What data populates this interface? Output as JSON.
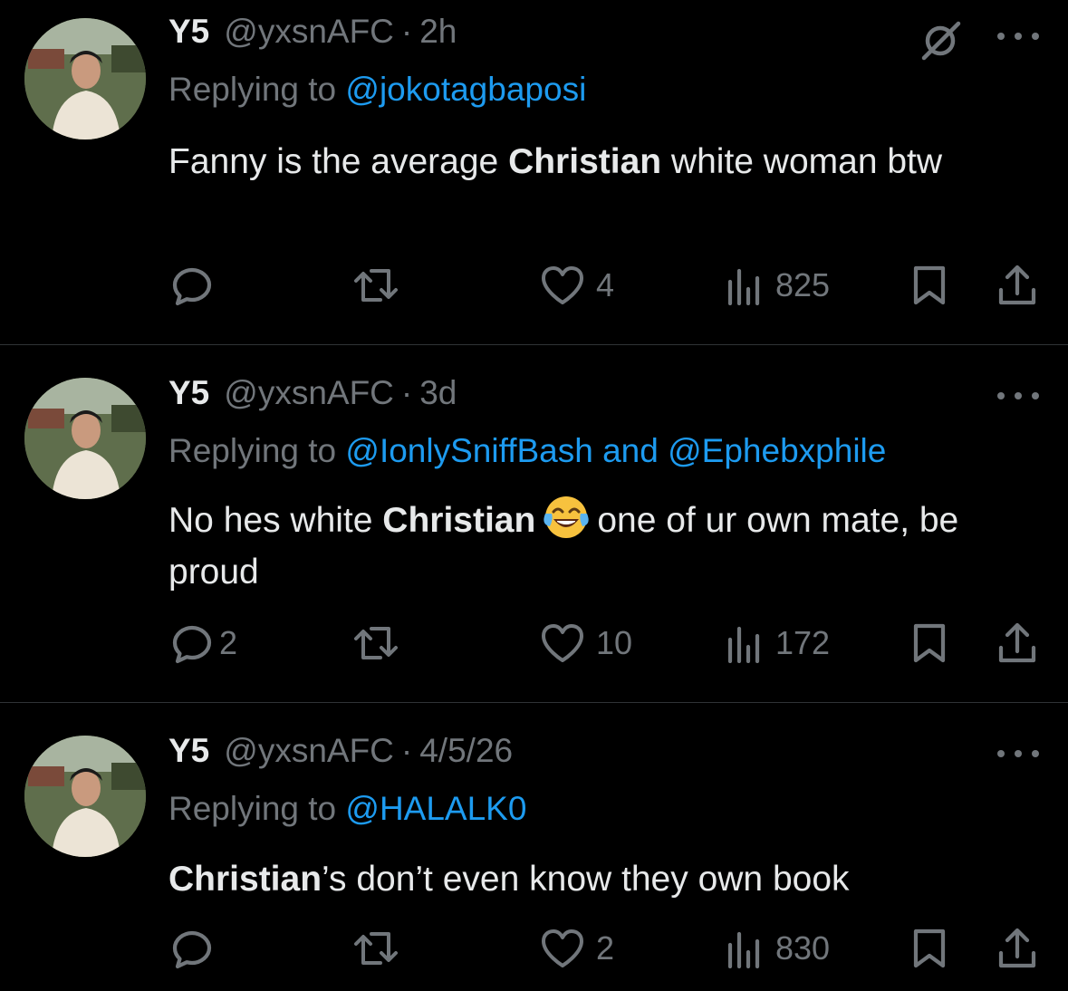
{
  "tweets": [
    {
      "name": "Y5",
      "handle": "@yxsnAFC",
      "separator": "·",
      "time": "2h",
      "reply_prefix": "Replying to ",
      "reply_handle_1": "@jokotagbaposi",
      "reply_and": "",
      "reply_handle_2": "",
      "text_a": "Fanny is the average ",
      "text_bold": "Christian",
      "text_b": " white woman btw",
      "emoji": "",
      "text_c": "",
      "stats": {
        "replies": "",
        "retweets": "",
        "likes": "4",
        "views": "825"
      },
      "muted_icon": "mute-circle-slash-icon"
    },
    {
      "name": "Y5",
      "handle": "@yxsnAFC",
      "separator": "·",
      "time": "3d",
      "reply_prefix": "Replying to ",
      "reply_handle_1": "@IonlySniffBash",
      "reply_and": " and ",
      "reply_handle_2": "@Ephebxphile",
      "text_a": "No hes white ",
      "text_bold": "Christian",
      "text_b": "",
      "emoji": "face-with-tears-of-joy",
      "text_c": "one of ur own mate, be proud",
      "stats": {
        "replies": "2",
        "retweets": "",
        "likes": "10",
        "views": "172"
      }
    },
    {
      "name": "Y5",
      "handle": "@yxsnAFC",
      "separator": "·",
      "time": "4/5/26",
      "reply_prefix": "Replying to ",
      "reply_handle_1": "@HALALK0",
      "reply_and": "",
      "reply_handle_2": "",
      "text_a": "",
      "text_bold": "Christian",
      "text_b": "’s don’t even know they own book",
      "emoji": "",
      "text_c": "",
      "stats": {
        "replies": "",
        "retweets": "",
        "likes": "2",
        "views": "830"
      }
    }
  ],
  "colors": {
    "background": "#000000",
    "text": "#e7e9ea",
    "secondary": "#71767b",
    "link": "#1d9bf0",
    "divider": "#2f3336"
  }
}
